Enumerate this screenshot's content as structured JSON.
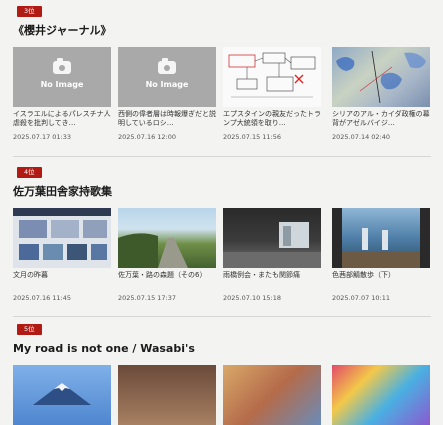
{
  "sections": [
    {
      "rank": "3位",
      "title": "《櫻井ジャーナル》",
      "posts": [
        {
          "thumb": "no-image",
          "no_image_text": "No Image",
          "caption": "イスラエルによるパレスチナ人虐殺を批判してき…",
          "date": "2025.07.17 01:33"
        },
        {
          "thumb": "no-image",
          "no_image_text": "No Image",
          "caption": "西側の偉者層は時報爆ぎだと説明しているロシ…",
          "date": "2025.07.16 12:00"
        },
        {
          "thumb": "diagram",
          "caption": "エプスタインの親友だったトランプ大統領を取り…",
          "date": "2025.07.15 11:56"
        },
        {
          "thumb": "map",
          "caption": "シリアのアル・カイダ政権の幕背がアゼルバイジ…",
          "date": "2025.07.14 02:40"
        }
      ]
    },
    {
      "rank": "4位",
      "title": "佐万葉田舎家持歌集",
      "posts": [
        {
          "thumb": "app",
          "caption": "文月の昨暮",
          "date": "2025.07.16 11:45"
        },
        {
          "thumb": "road",
          "caption": "佐万葉・路の森題（その6）",
          "date": "2025.07.15 17:37"
        },
        {
          "thumb": "tunnel",
          "caption": "雨橋例会・またも関節痛",
          "date": "2025.07.10 15:18"
        },
        {
          "thumb": "beach",
          "caption": "色茜部鯖散歩（下）",
          "date": "2025.07.07 10:11"
        }
      ]
    },
    {
      "rank": "5位",
      "title": "My road is not one / Wasabi's",
      "posts": [
        {
          "thumb": "fuji"
        },
        {
          "thumb": "person"
        },
        {
          "thumb": "toys"
        },
        {
          "thumb": "colorful"
        }
      ]
    }
  ]
}
